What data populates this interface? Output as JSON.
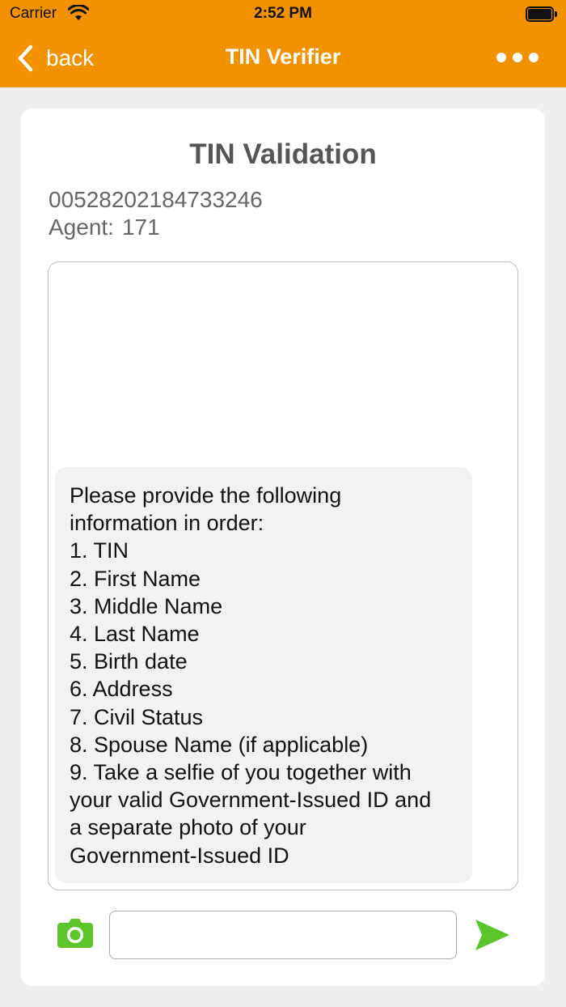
{
  "status_bar": {
    "carrier": "Carrier",
    "time": "2:52 PM",
    "icons": [
      "wifi-icon",
      "battery-icon"
    ]
  },
  "nav": {
    "back_label": "back",
    "title": "TIN Verifier",
    "icons": [
      "chevron-left-icon",
      "more-icon"
    ]
  },
  "card": {
    "title": "TIN Validation",
    "tin_number": "00528202184733246",
    "agent_label": "Agent:",
    "agent_value": "171"
  },
  "chat": {
    "message_intro": "Please provide the following\ninformation in order:",
    "items": [
      "1. TIN",
      "2. First Name",
      "3. Middle Name",
      "4. Last Name",
      "5. Birth date",
      "6. Address",
      "7. Civil Status",
      "8. Spouse Name (if applicable)",
      "9. Take a selfie of you together with",
      "your valid Government-Issued ID and",
      "a separate photo of your",
      "Government-Issued ID"
    ]
  },
  "composer": {
    "input_value": "",
    "input_placeholder": "",
    "icons": [
      "camera-icon",
      "send-icon"
    ]
  },
  "colors": {
    "header": "#f39200",
    "action_green": "#5cc52a",
    "background": "#efefef"
  }
}
